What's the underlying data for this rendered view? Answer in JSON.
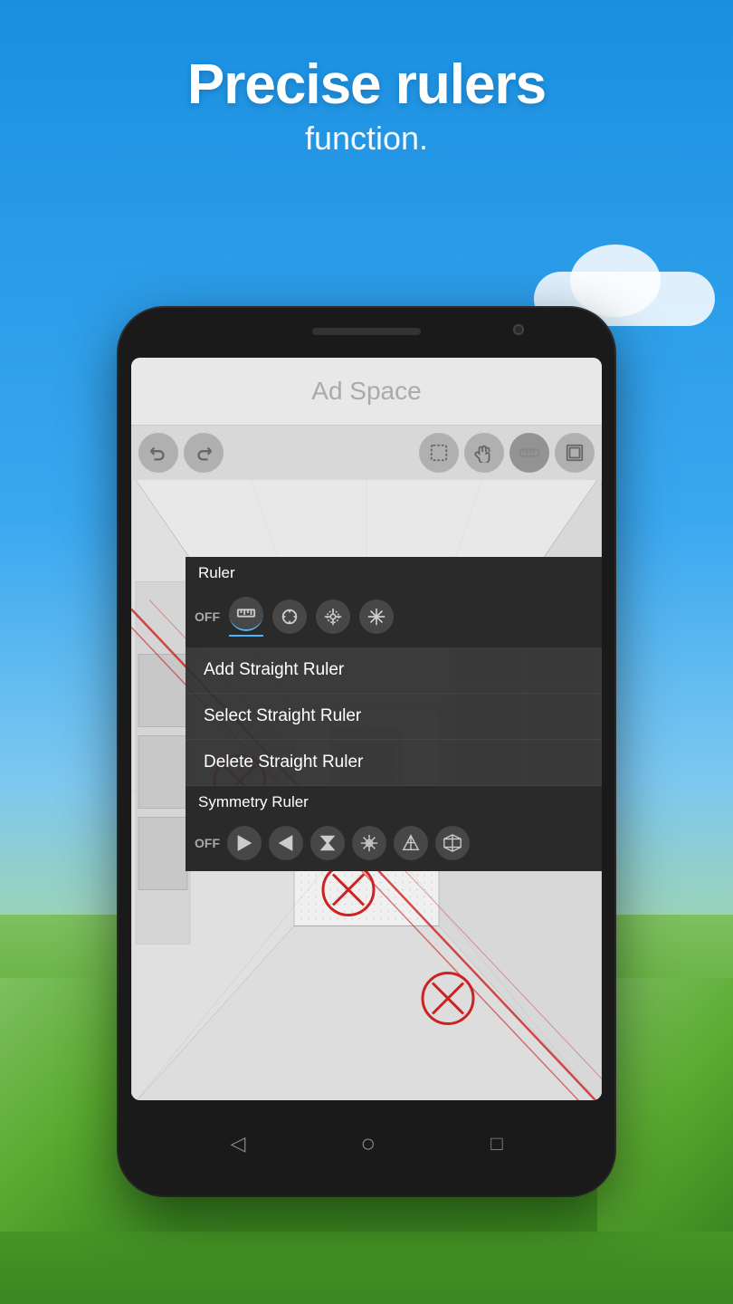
{
  "background": {
    "sky_color": "#1a8fe0",
    "meadow_color": "#5aaa30"
  },
  "header": {
    "title_main": "Precise rulers",
    "title_sub": "function."
  },
  "ad_space": {
    "label": "Ad Space"
  },
  "toolbar": {
    "buttons": [
      {
        "name": "undo",
        "icon": "↩",
        "label": "Undo"
      },
      {
        "name": "redo",
        "icon": "↪",
        "label": "Redo"
      },
      {
        "name": "select",
        "icon": "⬡",
        "label": "Select"
      },
      {
        "name": "hand",
        "icon": "✋",
        "label": "Hand"
      },
      {
        "name": "ruler-tool",
        "icon": "📏",
        "label": "Ruler"
      },
      {
        "name": "layer",
        "icon": "⧉",
        "label": "Layer"
      }
    ]
  },
  "ruler_menu": {
    "header": "Ruler",
    "off_label": "OFF",
    "icons": [
      {
        "name": "straight-ruler-icon",
        "active": true
      },
      {
        "name": "circle-ruler-icon",
        "active": false
      },
      {
        "name": "perspective-ruler-icon",
        "active": false
      },
      {
        "name": "radial-ruler-icon",
        "active": false
      }
    ],
    "items": [
      {
        "label": "Add Straight Ruler",
        "name": "add-straight-ruler"
      },
      {
        "label": "Select Straight Ruler",
        "name": "select-straight-ruler"
      },
      {
        "label": "Delete Straight Ruler",
        "name": "delete-straight-ruler"
      }
    ]
  },
  "symmetry_menu": {
    "header": "Symmetry Ruler",
    "off_label": "OFF",
    "icons": [
      {
        "name": "mirror-h-icon"
      },
      {
        "name": "mirror-v-icon"
      },
      {
        "name": "mirror-cross-icon"
      },
      {
        "name": "radial-sym-icon"
      },
      {
        "name": "triangle-sym-icon"
      },
      {
        "name": "cube-sym-icon"
      }
    ]
  },
  "bottom_nav": {
    "back_label": "◁",
    "home_label": "○",
    "recent_label": "□"
  }
}
